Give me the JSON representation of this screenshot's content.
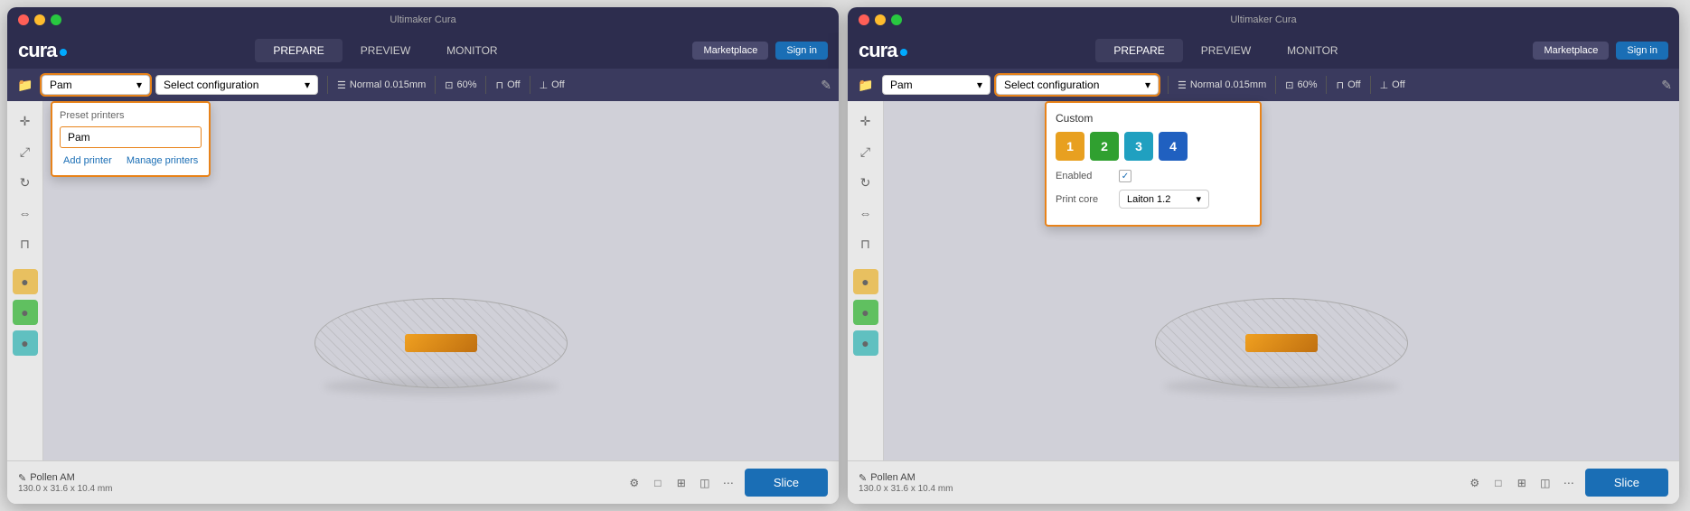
{
  "app": {
    "title": "Ultimaker Cura",
    "left_window_title": "Ultimaker Cura",
    "right_window_title": "Ultimaker Cura"
  },
  "nav": {
    "prepare_label": "PREPARE",
    "preview_label": "PREVIEW",
    "monitor_label": "MONITOR",
    "marketplace_label": "Marketplace",
    "signin_label": "Sign in"
  },
  "left_window": {
    "printer_name": "Pam",
    "config_label": "Select configuration",
    "print_profile": "Normal 0.015mm",
    "scale_pct": "60%",
    "support_label": "Off",
    "adhesion_label": "Off",
    "dropdown": {
      "section_title": "Preset printers",
      "printer_item": "Pam",
      "add_btn": "Add printer",
      "manage_btn": "Manage printers"
    }
  },
  "right_window": {
    "printer_name": "Pam",
    "config_label": "Select configuration",
    "print_profile": "Normal 0.015mm",
    "scale_pct": "60%",
    "support_label": "Off",
    "adhesion_label": "Off",
    "config_dropdown": {
      "section_title": "Custom",
      "swatches": [
        {
          "color": "yellow",
          "label": "1"
        },
        {
          "color": "green",
          "label": "2"
        },
        {
          "color": "cyan",
          "label": "3"
        },
        {
          "color": "blue",
          "label": "4"
        }
      ],
      "enabled_label": "Enabled",
      "print_core_label": "Print core",
      "print_core_value": "Laiton 1.2"
    }
  },
  "bottom": {
    "filename": "Pollen AM",
    "dimensions": "130.0 x 31.6 x 10.4 mm",
    "slice_btn": "Slice"
  },
  "icons": {
    "chevron": "▾",
    "checkmark": "✓",
    "pencil": "✎",
    "folder": "📁",
    "close": "✕"
  }
}
